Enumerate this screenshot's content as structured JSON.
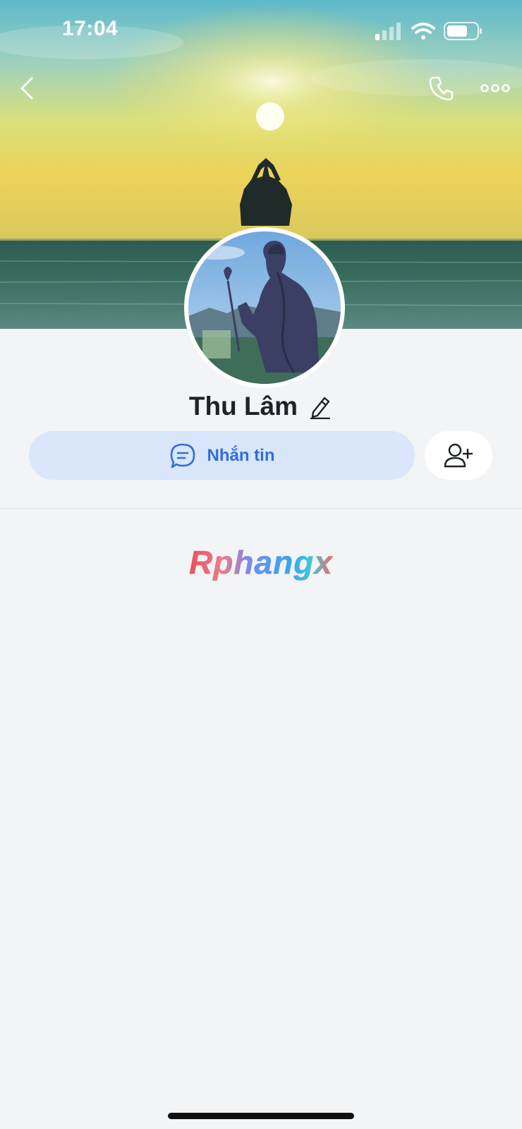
{
  "status_bar": {
    "time": "17:04"
  },
  "nav": {
    "back_icon": "chevron-left-icon",
    "call_icon": "phone-icon",
    "more_icon": "more-dots-icon"
  },
  "profile": {
    "name": "Thu Lâm",
    "edit_icon": "pencil-icon"
  },
  "actions": {
    "message_label": "Nhắn tin",
    "message_icon": "chat-bubble-icon",
    "add_friend_icon": "add-user-icon"
  },
  "watermark": {
    "text": "Rphangx"
  },
  "colors": {
    "accent": "#2f6ee0",
    "message_bg": "#d9e6fb",
    "page_bg": "#f3f4f6"
  }
}
